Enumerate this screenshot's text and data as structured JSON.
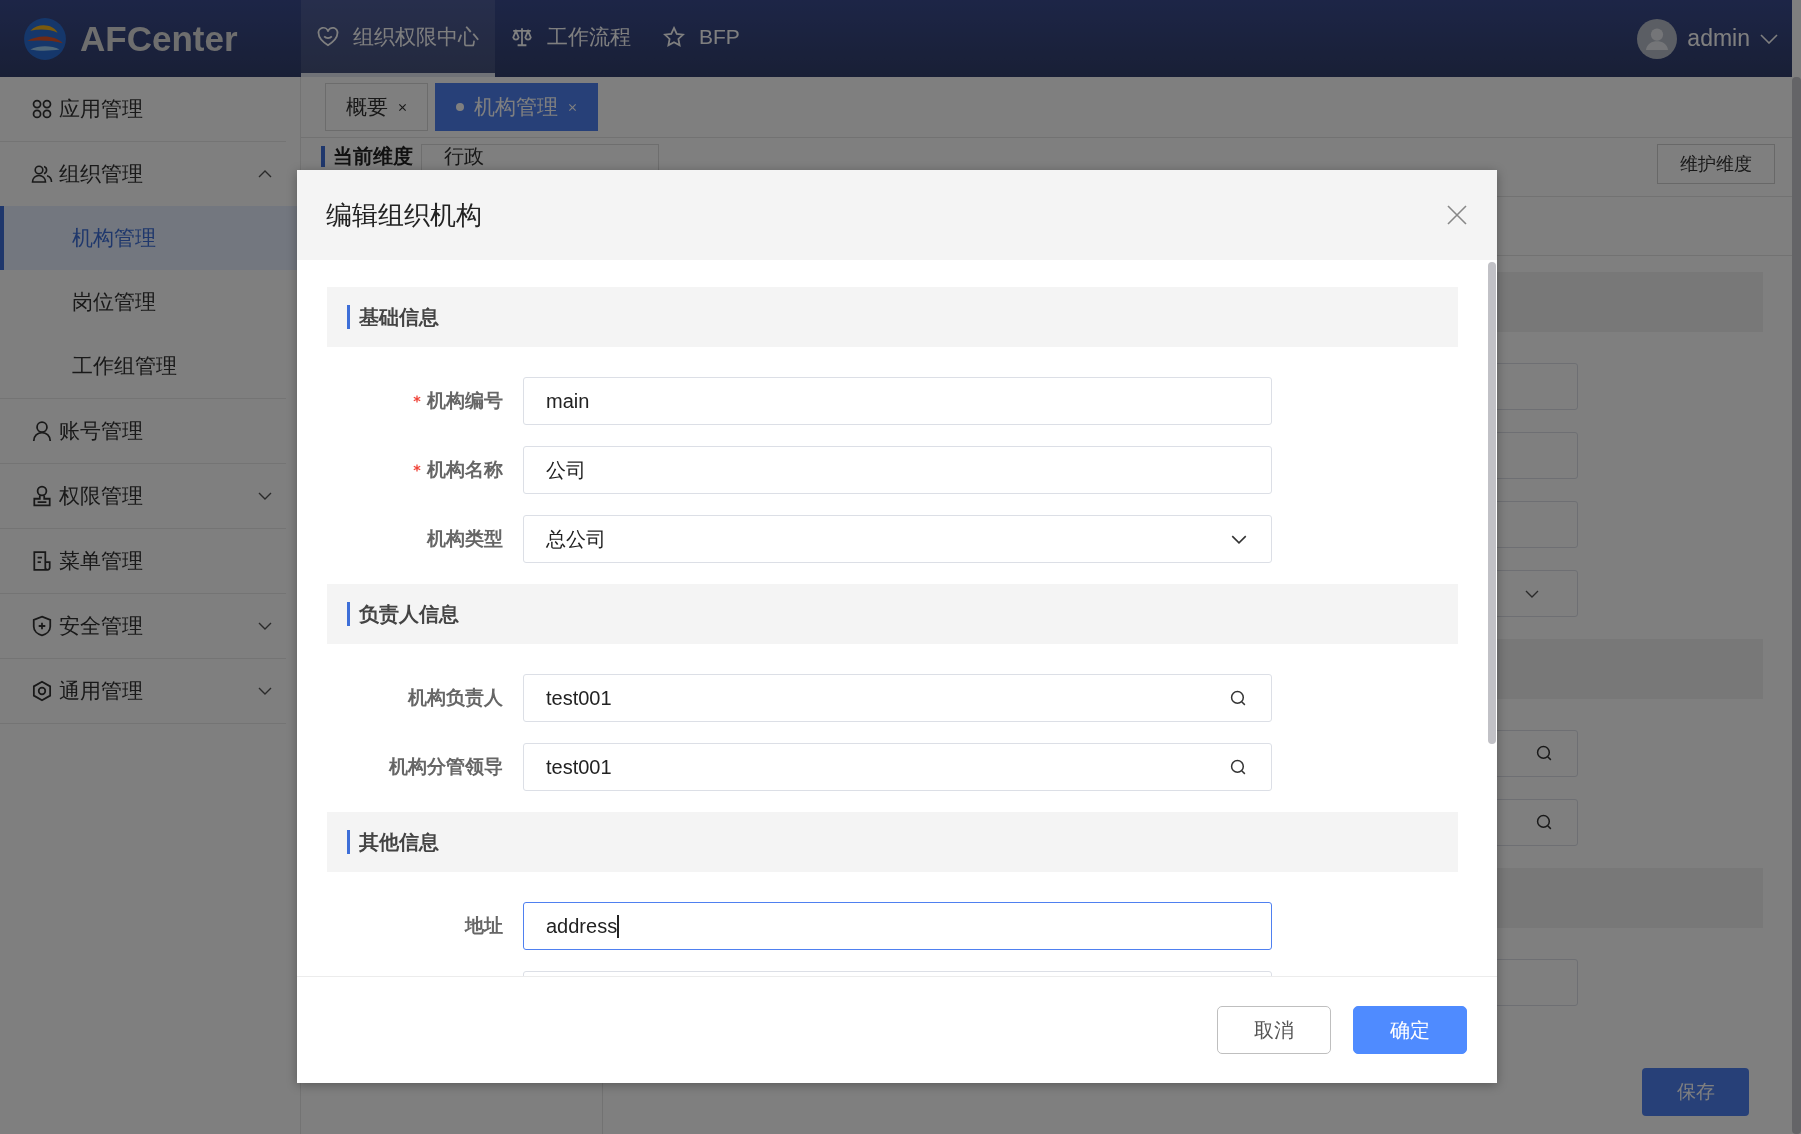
{
  "header": {
    "logo": "AFCenter",
    "nav": [
      {
        "label": "组织权限中心",
        "selected": true
      },
      {
        "label": "工作流程",
        "selected": false
      },
      {
        "label": "BFP",
        "selected": false
      }
    ],
    "user": "admin"
  },
  "sidebar": {
    "items": [
      {
        "label": "应用管理"
      },
      {
        "label": "组织管理",
        "expanded": true,
        "children": [
          {
            "label": "机构管理",
            "selected": true
          },
          {
            "label": "岗位管理",
            "selected": false
          },
          {
            "label": "工作组管理",
            "selected": false
          }
        ]
      },
      {
        "label": "账号管理"
      },
      {
        "label": "权限管理",
        "expanded": false
      },
      {
        "label": "菜单管理"
      },
      {
        "label": "安全管理",
        "expanded": false
      },
      {
        "label": "通用管理",
        "expanded": false
      }
    ]
  },
  "tabs": [
    {
      "label": "概要",
      "selected": false
    },
    {
      "label": "机构管理",
      "selected": true
    }
  ],
  "dimension": {
    "label": "当前维度",
    "value": "行政",
    "button": "维护维度"
  },
  "background_form": [
    {
      "kind": "section"
    },
    {
      "kind": "input"
    },
    {
      "kind": "input"
    },
    {
      "kind": "input"
    },
    {
      "kind": "select"
    },
    {
      "kind": "section"
    },
    {
      "kind": "search"
    },
    {
      "kind": "search"
    },
    {
      "kind": "section"
    },
    {
      "kind": "input"
    }
  ],
  "save_button": "保存",
  "dialog": {
    "title": "编辑组织机构",
    "sections": [
      {
        "title": "基础信息",
        "fields": [
          {
            "label": "机构编号",
            "required": true,
            "kind": "input",
            "value": "main",
            "focused": false
          },
          {
            "label": "机构名称",
            "required": true,
            "kind": "input",
            "value": "公司",
            "focused": false
          },
          {
            "label": "机构类型",
            "required": false,
            "kind": "select",
            "value": "总公司",
            "focused": false
          }
        ]
      },
      {
        "title": "负责人信息",
        "fields": [
          {
            "label": "机构负责人",
            "required": false,
            "kind": "search",
            "value": "test001",
            "focused": false
          },
          {
            "label": "机构分管领导",
            "required": false,
            "kind": "search",
            "value": "test001",
            "focused": false
          }
        ]
      },
      {
        "title": "其他信息",
        "fields": [
          {
            "label": "地址",
            "required": false,
            "kind": "input",
            "value": "address",
            "focused": true
          },
          {
            "kind": "input"
          }
        ]
      }
    ],
    "buttons": [
      {
        "label": "取消",
        "kind": "default"
      },
      {
        "label": "确定",
        "kind": "primary"
      }
    ]
  }
}
